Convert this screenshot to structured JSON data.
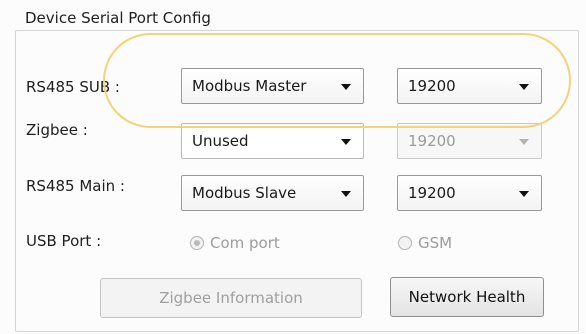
{
  "group": {
    "title": "Device Serial Port Config"
  },
  "rows": {
    "rs485_sub": {
      "label": "RS485 SUB :",
      "mode": "Modbus Master",
      "baud": "19200"
    },
    "zigbee": {
      "label": "Zigbee :",
      "mode": "Unused",
      "baud": "19200"
    },
    "rs485_main": {
      "label": "RS485 Main :",
      "mode": "Modbus Slave",
      "baud": "19200"
    },
    "usb": {
      "label": "USB Port :",
      "option_com": "Com port",
      "option_gsm": "GSM"
    }
  },
  "buttons": {
    "zigbee_info": "Zigbee Information",
    "network_health": "Network Health"
  },
  "colors": {
    "highlight": "#f2d37a"
  }
}
